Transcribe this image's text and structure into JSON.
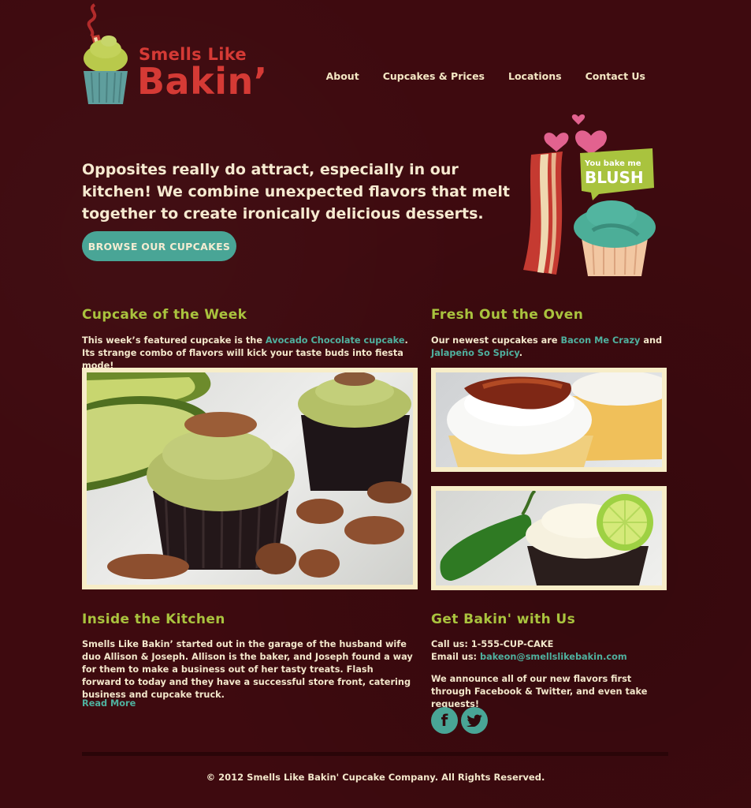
{
  "brand": {
    "line1": "Smells Like",
    "line2": "Bakin’"
  },
  "nav": {
    "items": [
      "About",
      "Cupcakes & Prices",
      "Locations",
      "Contact Us"
    ]
  },
  "hero": {
    "text": "Opposites really do attract, especially in our kitchen! We combine unexpected flavors that melt together to create ironically delicious desserts.",
    "cta": "BROWSE OUR CUPCAKES",
    "badge_small": "You bake me",
    "badge_big": "BLUSH"
  },
  "cupcake_week": {
    "title": "Cupcake of the Week",
    "text_before": "This week’s featured cupcake is the ",
    "link": "Avocado Chocolate cupcake",
    "text_after": ". Its strange combo of flavors will kick your taste buds into fiesta mode!"
  },
  "fresh": {
    "title": "Fresh Out the Oven",
    "text_before": "Our newest cupcakes are ",
    "link1": "Bacon Me Crazy",
    "text_mid": " and ",
    "link2": "Jalapeño So Spicy",
    "text_after": "."
  },
  "kitchen": {
    "title": "Inside the Kitchen",
    "text": "Smells Like Bakin’ started out in the garage of the husband wife duo Allison & Joseph. Allison is the baker, and Joseph found a way for them to make a business out of her tasty treats. Flash forward to today and they have a successful store front, catering business and cupcake truck.",
    "read_more": "Read More"
  },
  "contact": {
    "title": "Get Bakin' with Us",
    "call": "Call us: 1-555-CUP-CAKE",
    "email_label": "Email us: ",
    "email": "bakeon@smellslikebakin.com",
    "announce": "We announce all of our new flavors first through Facebook & Twitter, and even take requests!",
    "facebook_glyph": "f"
  },
  "footer": {
    "text": "© 2012 Smells Like Bakin' Cupcake Company. All Rights Reserved."
  },
  "colors": {
    "background": "#3e0a0f",
    "accent_teal": "#49a596",
    "heading_green": "#a9c33e",
    "logo_red": "#d53a35",
    "cream": "#f7edc8"
  }
}
